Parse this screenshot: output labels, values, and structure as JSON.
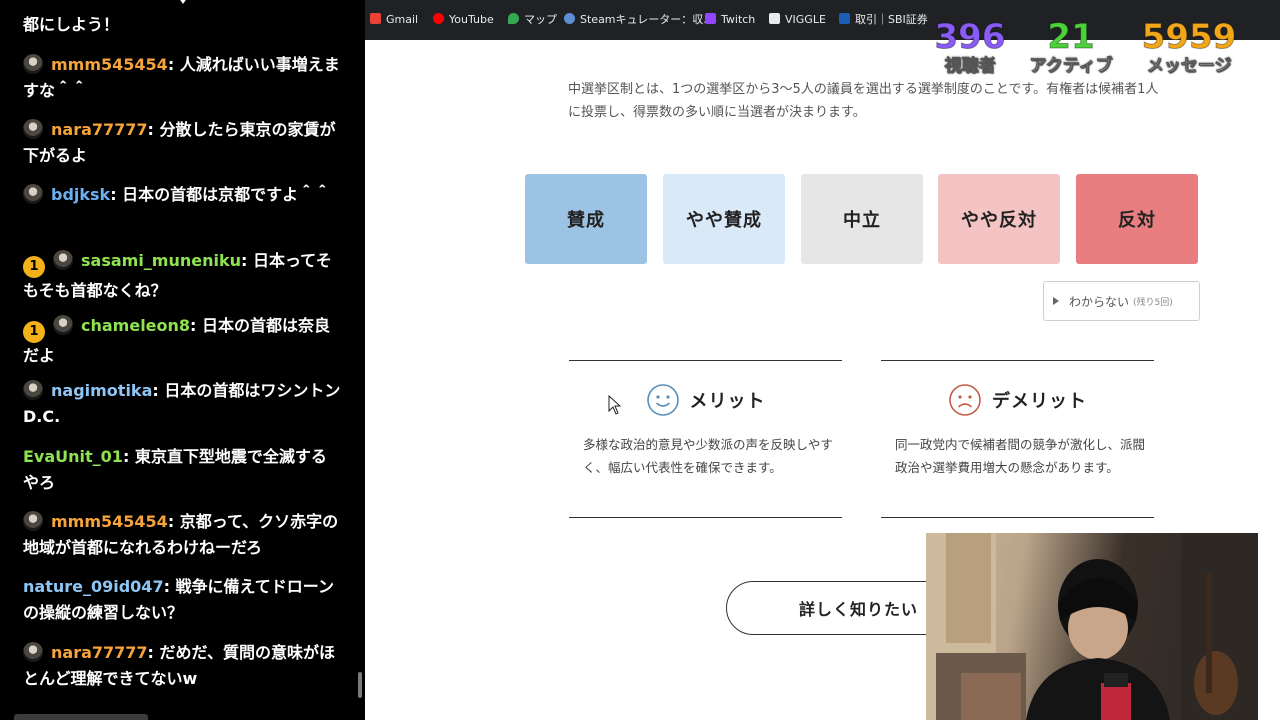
{
  "chat": {
    "messages": [
      {
        "user": "",
        "text": "都にしよう！",
        "color": "#ffffff",
        "badge": "",
        "avatar": false
      },
      {
        "user": "mmm545454",
        "text": ": 人減ればいい事増えますな＾＾",
        "color": "#f5a33a",
        "badge": "",
        "avatar": true
      },
      {
        "user": "nara77777",
        "text": ": 分散したら東京の家賃が下がるよ",
        "color": "#f5a33a",
        "badge": "",
        "avatar": true
      },
      {
        "user": "bdjksk",
        "text": ": 日本の首都は京都ですよ＾＾",
        "color": "#6ab0f3",
        "badge": "",
        "avatar": true
      },
      {
        "user": "sasami_muneniku",
        "text": ": 日本ってそもそも首都なくね？",
        "color": "#8fe34e",
        "badge": "1",
        "avatar": true
      },
      {
        "user": "chameleon8",
        "text": ": 日本の首都は奈良だよ",
        "color": "#8fe34e",
        "badge": "1",
        "avatar": true
      },
      {
        "user": "nagimotika",
        "text": ": 日本の首都はワシントンD.C.",
        "color": "#8ec5f5",
        "badge": "",
        "avatar": true
      },
      {
        "user": "EvaUnit_01",
        "text": ": 東京直下型地震で全滅するやろ",
        "color": "#8fe34e",
        "badge": "",
        "avatar": false
      },
      {
        "user": "mmm545454",
        "text": ": 京都って、クソ赤字の地域が首都になれるわけねーだろ",
        "color": "#f5a33a",
        "badge": "",
        "avatar": true
      },
      {
        "user": "nature_09id047",
        "text": ": 戦争に備えてドローンの操縦の練習しない？",
        "color": "#8ec5f5",
        "badge": "",
        "avatar": false
      },
      {
        "user": "nara77777",
        "text": ": だめだ、質問の意味がほとんど理解できてないw",
        "color": "#f5a33a",
        "badge": "",
        "avatar": true
      }
    ]
  },
  "bookmarks": [
    {
      "label": "Gmail",
      "icon": "gmail-icon",
      "color": "#ea4335"
    },
    {
      "label": "YouTube",
      "icon": "youtube-icon",
      "color": "#ff0000"
    },
    {
      "label": "マップ",
      "icon": "maps-icon",
      "color": "#34a853"
    },
    {
      "label": "Steamキュレーター：収...",
      "icon": "steam-icon",
      "color": "#5b8fd6"
    },
    {
      "label": "Twitch",
      "icon": "twitch-icon",
      "color": "#9146ff"
    },
    {
      "label": "VIGGLE",
      "icon": "viggle-icon",
      "color": "#e8eaed"
    },
    {
      "label": "取引｜SBI証券",
      "icon": "sbi-icon",
      "color": "#1a5fb4"
    }
  ],
  "stats": {
    "viewers": {
      "value": "396",
      "label": "視聴者",
      "color": "#8a5cf6"
    },
    "active": {
      "value": "21",
      "label": "アクティブ",
      "color": "#4cd13a"
    },
    "messages": {
      "value": "5959",
      "label": "メッセージ",
      "color": "#f2a71b"
    }
  },
  "page": {
    "description": "中選挙区制とは、1つの選挙区から3〜5人の議員を選出する選挙制度のことです。有権者は候補者1人に投票し、得票数の多い順に当選者が決まります。",
    "votes": [
      {
        "label": "賛成",
        "color": "#9cc3e4"
      },
      {
        "label": "やや賛成",
        "color": "#d9e9f8"
      },
      {
        "label": "中立",
        "color": "#e6e6e6"
      },
      {
        "label": "やや反対",
        "color": "#f4c3c3"
      },
      {
        "label": "反対",
        "color": "#e87e80"
      }
    ],
    "unknown": {
      "label": "わからない",
      "remaining": "(残り5回)"
    },
    "merit": {
      "title": "メリット",
      "body": "多様な政治的意見や少数派の声を反映しやすく、幅広い代表性を確保できます。"
    },
    "demerit": {
      "title": "デメリット",
      "body": "同一政党内で候補者間の競争が激化し、派閥政治や選挙費用増大の懸念があります。"
    },
    "more_button": "詳しく知りたい"
  }
}
